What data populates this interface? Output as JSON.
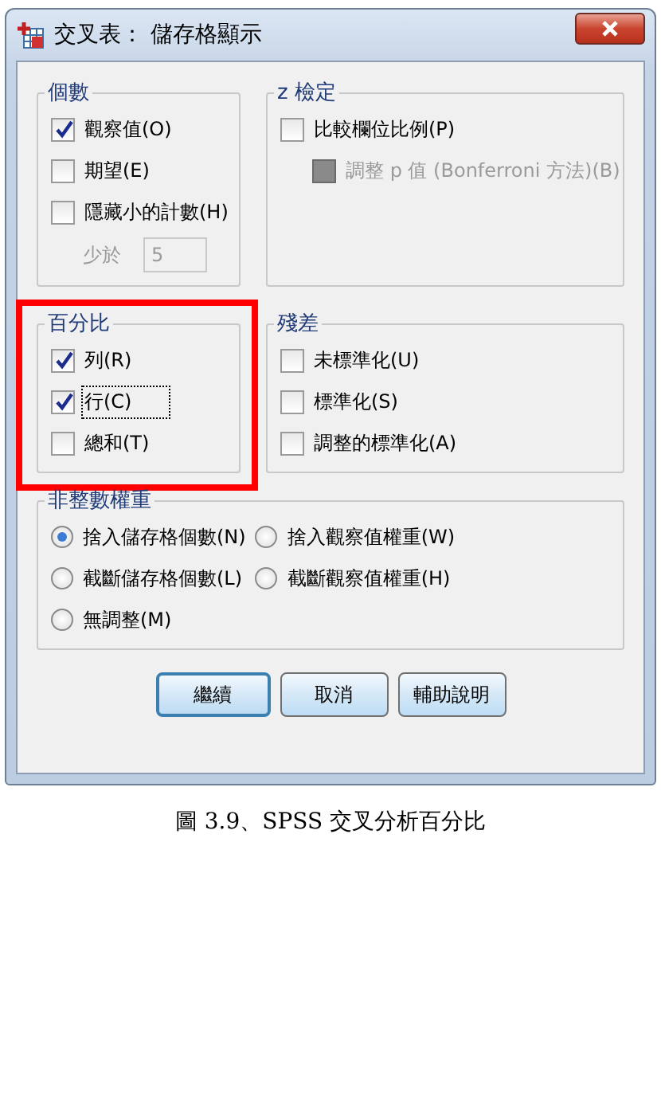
{
  "window": {
    "title": "交叉表： 儲存格顯示"
  },
  "counts": {
    "title": "個數",
    "items": [
      {
        "label": "觀察值(O)",
        "checked": true,
        "disabled": false,
        "focused": false
      },
      {
        "label": "期望(E)",
        "checked": false,
        "disabled": false,
        "focused": false
      },
      {
        "label": "隱藏小的計數(H)",
        "checked": false,
        "disabled": false,
        "focused": false
      }
    ],
    "threshold": {
      "label": "少於",
      "value": "5",
      "disabled": true
    }
  },
  "z_test": {
    "title": "z 檢定",
    "items": [
      {
        "label": "比較欄位比例(P)",
        "checked": false,
        "disabled": false,
        "focused": false,
        "children": [
          {
            "label": "調整 p 值 (Bonferroni 方法)(B)",
            "checked": false,
            "disabled": true,
            "focused": false
          }
        ]
      }
    ]
  },
  "percentages": {
    "title": "百分比",
    "highlighted": true,
    "items": [
      {
        "label": "列(R)",
        "checked": true,
        "disabled": false,
        "focused": false
      },
      {
        "label": "行(C)",
        "checked": true,
        "disabled": false,
        "focused": true
      },
      {
        "label": "總和(T)",
        "checked": false,
        "disabled": false,
        "focused": false
      }
    ]
  },
  "residuals": {
    "title": "殘差",
    "items": [
      {
        "label": "未標準化(U)",
        "checked": false,
        "disabled": false,
        "focused": false
      },
      {
        "label": "標準化(S)",
        "checked": false,
        "disabled": false,
        "focused": false
      },
      {
        "label": "調整的標準化(A)",
        "checked": false,
        "disabled": false,
        "focused": false
      }
    ]
  },
  "noninteger_weights": {
    "title": "非整數權重",
    "options": [
      {
        "label": "捨入儲存格個數(N)",
        "selected": true
      },
      {
        "label": "捨入觀察值權重(W)",
        "selected": false
      },
      {
        "label": "截斷儲存格個數(L)",
        "selected": false
      },
      {
        "label": "截斷觀察值權重(H)",
        "selected": false
      },
      {
        "label": "無調整(M)",
        "selected": false
      }
    ]
  },
  "buttons": [
    {
      "label": "繼續",
      "default": true
    },
    {
      "label": "取消",
      "default": false
    },
    {
      "label": "輔助說明",
      "default": false
    }
  ],
  "caption": "圖 3.9、SPSS 交叉分析百分比"
}
